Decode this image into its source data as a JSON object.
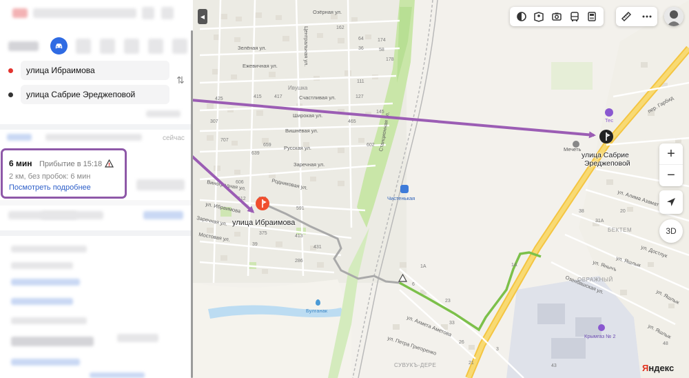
{
  "route_form": {
    "from_value": "улица Ибраимова",
    "to_value": "улица Сабрие Эреджеповой",
    "from_dot_color": "#e3342f",
    "to_dot_color": "#333333",
    "mode_icon": "car-icon",
    "swap_icon": "swap-vertical-icon"
  },
  "route_card": {
    "time": "6 мин",
    "arrival": "Прибытие в 15:18",
    "distance": "2 км, без пробок: 6 мин",
    "details_link": "Посмотреть подробнее",
    "warning_icon": "traffic-warning-icon",
    "highlight_color": "#8e58a8"
  },
  "partial": {
    "sidebar_clipped_text": "сейчас"
  },
  "map": {
    "origin_label": "улица Ибраимова",
    "destination_label_line1": "улица Сабрие",
    "destination_label_line2": "Эреджеповой",
    "origin_pin_color": "#f04e2e",
    "route_color": "#7cc04a",
    "alt_route_color": "#a9a9a9",
    "annotation_arrow_color": "#9b5db4",
    "streets": {
      "ozernaya": "Озёрная ул.",
      "zelenaya": "Зелёная ул.",
      "ezhevichnaya": "Ежевичная ул.",
      "tsentralnaya": "Центральная ул.",
      "ivushka": "Ивушка",
      "schastlivaya": "Счастливая ул.",
      "shirokaya": "Широкая ул.",
      "vishnevaya": "Вишнёвая ул.",
      "russkaya": "Русская ул.",
      "zarechnaya": "Заречная ул.",
      "vinogradnaya": "Виноградная ул.",
      "rodnikovaya": "Родниковая ул.",
      "ibraimova": "ул. Ибраимова",
      "zarechnaya2": "Заречная ул.",
      "mostovaya": "Мостовая ул.",
      "stantsionnaya": "Станционная ул.",
      "perehod": "пер. Гарбид",
      "alima_azamat": "ул. Алима Азамат",
      "dostluk": "ул. Достлук",
      "yanych": "ул. Янычъ",
      "yashlyk": "ул. Яшлык",
      "ozenbashskaya": "Озенбашская ул.",
      "yashlyk2": "ул. Яшлык",
      "ametova": "ул. Ахмета Аметова",
      "grigorenko": "ул. Петра Григоренко",
      "yashlyk3": "ул. Яшлык"
    },
    "places": {
      "chistenkaya": "Чистенькая",
      "bulganak": "Булганак",
      "mosque": "Мечеть",
      "tes": "Тес",
      "bektemir": "БЕКТЕМ",
      "ovrazhny": "ОВРАЖНЫЙ",
      "krymgaz": "Крымгаз № 2",
      "suvuk_dere": "СУВУКЪ-ДЕРЕ"
    },
    "house_numbers": {
      "n174": "174",
      "n162": "162",
      "n64": "64",
      "n36": "36",
      "n58": "58",
      "n178": "178",
      "n425": "425",
      "n415": "415",
      "n417": "417",
      "n111": "111",
      "n127": "127",
      "n145": "145",
      "n307": "307",
      "n465": "465",
      "n707": "707",
      "n639": "639",
      "n659": "659",
      "n602": "602",
      "n606": "606",
      "n612": "612",
      "n618": "618",
      "n591": "591",
      "n375": "375",
      "n413": "413",
      "n431": "431",
      "n286": "286",
      "n39": "39",
      "n1a": "1А",
      "n6": "6",
      "n23": "23",
      "n33": "33",
      "n26": "26",
      "n21": "21",
      "n38": "38",
      "n31a": "31А",
      "n20": "20",
      "n1a2": "1А",
      "n43": "43",
      "n3": "3",
      "n48": "48"
    }
  },
  "toolbar": {
    "layers_icon": "layers-icon",
    "panorama_icon": "panorama-icon",
    "camera_icon": "camera-icon",
    "transit_icon": "bus-icon",
    "traffic_icon": "traffic-icon",
    "ruler_icon": "ruler-icon",
    "more_icon": "more-dots-icon"
  },
  "controls": {
    "zoom_in": "+",
    "zoom_out": "−",
    "btn_3d": "3D"
  },
  "logo": {
    "brand_first": "Я",
    "brand_rest": "ндекс"
  }
}
